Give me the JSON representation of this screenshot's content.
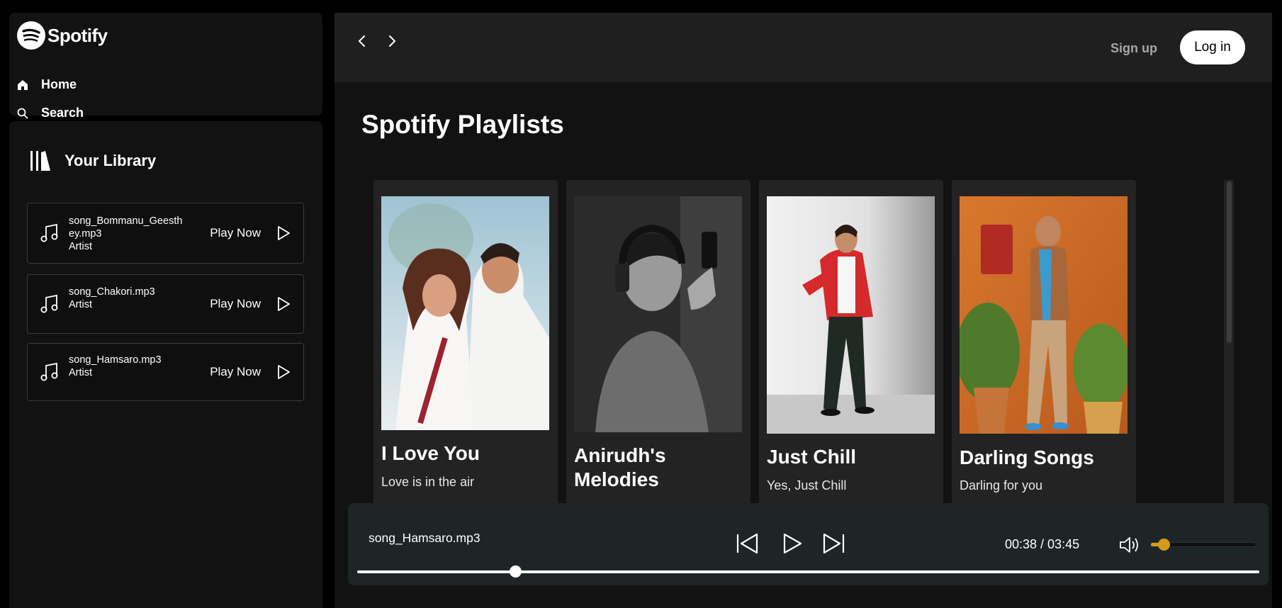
{
  "brand": {
    "name": "Spotify"
  },
  "nav": [
    {
      "label": "Home",
      "icon": "home-icon"
    },
    {
      "label": "Search",
      "icon": "search-icon"
    }
  ],
  "library": {
    "title": "Your Library",
    "songs": [
      {
        "name": "song_Bommanu_Geesthey.mp3",
        "name_line1": "song_Bommanu_Geesth",
        "name_line2": "ey.mp3",
        "artist": "Artist",
        "action": "Play Now"
      },
      {
        "name": "song_Chakori.mp3",
        "artist": "Artist",
        "action": "Play Now"
      },
      {
        "name": "song_Hamsaro.mp3",
        "artist": "Artist",
        "action": "Play Now"
      }
    ]
  },
  "header": {
    "signup": "Sign up",
    "login": "Log in"
  },
  "main": {
    "section_title": "Spotify Playlists",
    "playlists": [
      {
        "title": "I Love You",
        "description": "Love is in the air"
      },
      {
        "title": "Anirudh's Melodies",
        "description": ""
      },
      {
        "title": "Just Chill",
        "description": "Yes, Just Chill"
      },
      {
        "title": "Darling Songs",
        "description": "Darling for you"
      }
    ]
  },
  "player": {
    "now_playing": "song_Hamsaro.mp3",
    "time": "00:38 / 03:45",
    "current": "00:38",
    "duration": "03:45",
    "progress_fraction": 0.175,
    "volume_fraction": 0.12
  },
  "colors": {
    "accent": "#d49b1a",
    "background": "#000000",
    "panel": "#121212",
    "player": "#1e2526"
  }
}
